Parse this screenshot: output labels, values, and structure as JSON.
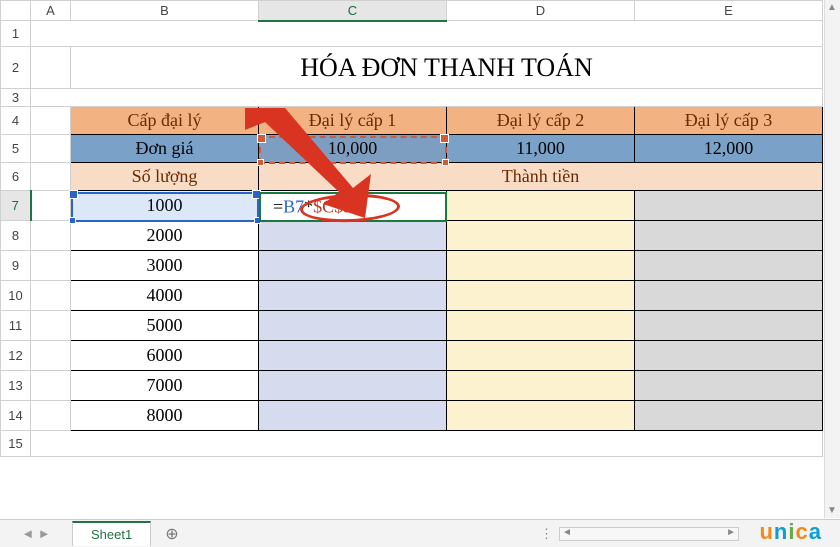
{
  "columns": [
    "A",
    "B",
    "C",
    "D",
    "E"
  ],
  "rows": [
    "1",
    "2",
    "3",
    "4",
    "5",
    "6",
    "7",
    "8",
    "9",
    "10",
    "11",
    "12",
    "13",
    "14",
    "15"
  ],
  "title": "HÓA ĐƠN THANH TOÁN",
  "headers": {
    "agent_level": "Cấp đại lý",
    "level1": "Đại lý cấp 1",
    "level2": "Đại lý cấp 2",
    "level3": "Đại lý cấp 3",
    "unit_price": "Đơn giá",
    "price1": "10,000",
    "price2": "11,000",
    "price3": "12,000",
    "quantity": "Số lượng",
    "amount": "Thành tiền"
  },
  "quantities": [
    "1000",
    "2000",
    "3000",
    "4000",
    "5000",
    "6000",
    "7000",
    "8000"
  ],
  "formula": {
    "eq": "=",
    "ref1": "B7",
    "op": "*",
    "ref2": "$C$5"
  },
  "active_cell": "C7",
  "sheet": {
    "name": "Sheet1"
  },
  "brand": "unica",
  "chart_data": {
    "type": "table",
    "title": "HÓA ĐƠN THANH TOÁN",
    "columns": [
      "Số lượng",
      "Đại lý cấp 1",
      "Đại lý cấp 2",
      "Đại lý cấp 3"
    ],
    "unit_prices": {
      "Đại lý cấp 1": 10000,
      "Đại lý cấp 2": 11000,
      "Đại lý cấp 3": 12000
    },
    "rows": [
      {
        "Số lượng": 1000
      },
      {
        "Số lượng": 2000
      },
      {
        "Số lượng": 3000
      },
      {
        "Số lượng": 4000
      },
      {
        "Số lượng": 5000
      },
      {
        "Số lượng": 6000
      },
      {
        "Số lượng": 7000
      },
      {
        "Số lượng": 8000
      }
    ],
    "formula_in_C7": "=B7*$C$5"
  }
}
